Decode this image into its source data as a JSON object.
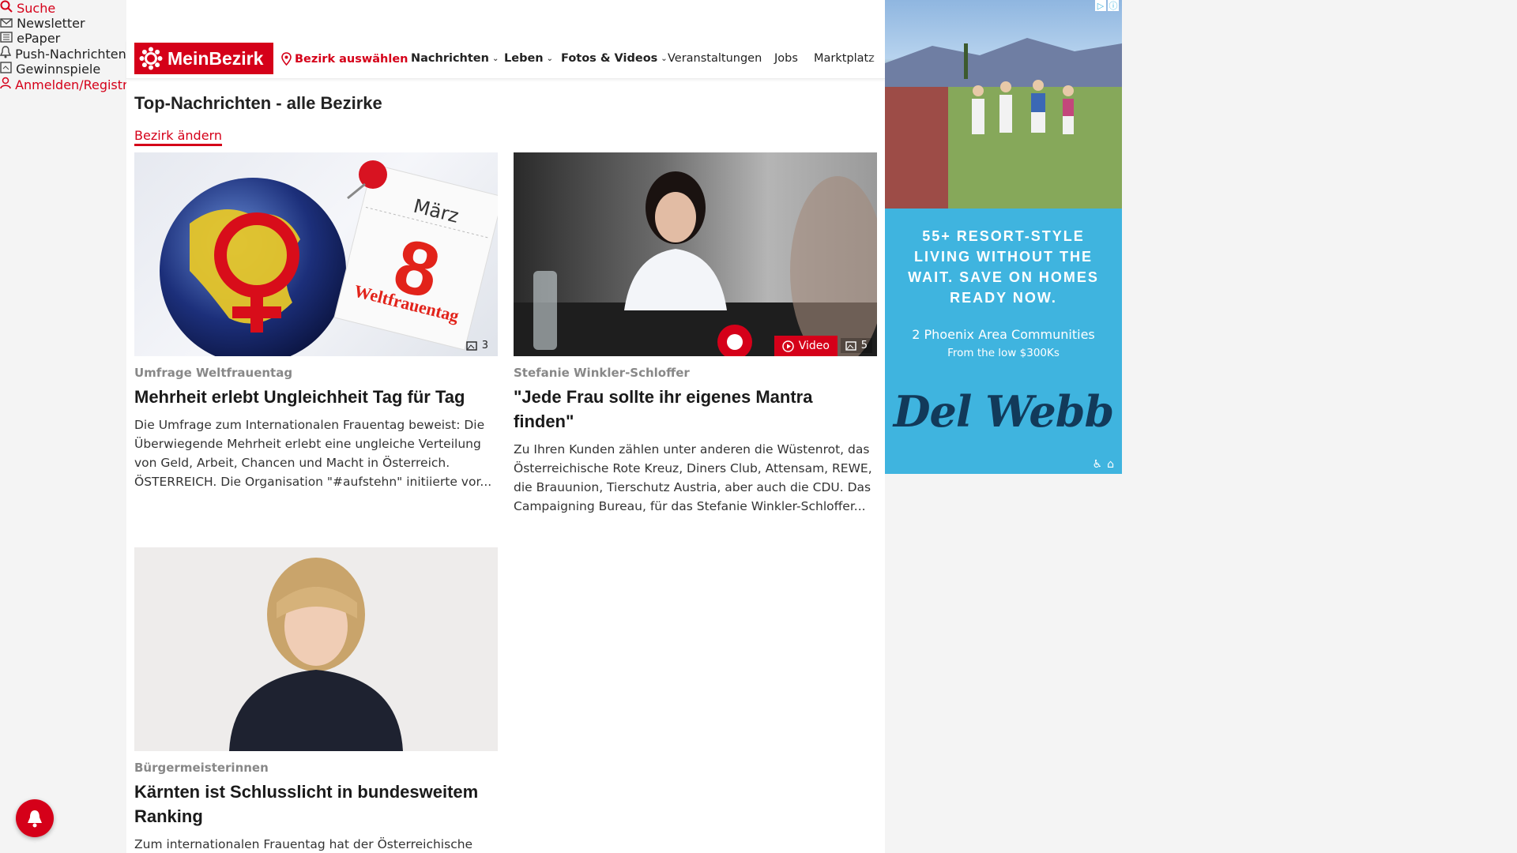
{
  "topbar": {
    "search": "Suche",
    "newsletter": "Newsletter",
    "epaper": "ePaper",
    "push": "Push-Nachrichten",
    "gewinnspiele": "Gewinnspiele",
    "login": "Anmelden/Registrieren"
  },
  "nav": {
    "logo": "MeinBezirk",
    "bezirk": "Bezirk auswählen",
    "items": [
      "Nachrichten",
      "Leben",
      "Fotos & Videos",
      "Veranstaltungen",
      "Jobs",
      "Marktplatz"
    ]
  },
  "page": {
    "title": "Top-Nachrichten - alle Bezirke",
    "change_link": "Bezirk ändern"
  },
  "articles": [
    {
      "category": "Umfrage Weltfrauentag",
      "headline": "Mehrheit erlebt Ungleichheit Tag für Tag",
      "teaser": "Die Umfrage zum Internationalen Frauentag beweist: Die Überwiegende Mehrheit erlebt eine ungleiche Verteilung von Geld, Arbeit, Chancen und Macht in Österreich. ÖSTERREICH. Die Organisation \"#aufstehn\" initiierte vor...",
      "image_count": "3",
      "image_calendar_month": "März",
      "image_calendar_day": "8",
      "image_calendar_label": "Weltfrauentag"
    },
    {
      "category": "Stefanie Winkler-Schloffer",
      "headline": "\"Jede Frau sollte ihr eigenes Mantra finden\"",
      "teaser": "Zu Ihren Kunden zählen unter anderen die Wüstenrot, das Österreichische Rote Kreuz, Diners Club, Attensam, REWE, die Brauunion, Tierschutz Austria, aber auch die CDU. Das Campaigning Bureau, für das Stefanie Winkler-Schloffer...",
      "video_label": "Video",
      "image_count": "5"
    },
    {
      "category": "Bürgermeisterinnen",
      "headline": "Kärnten ist Schlusslicht in bundesweitem Ranking",
      "teaser": "Zum internationalen Frauentag hat der Österreichische"
    }
  ],
  "ad": {
    "headline": "55+ RESORT-STYLE LIVING WITHOUT THE WAIT. SAVE ON HOMES READY NOW.",
    "sub": "2 Phoenix Area Communities",
    "sub2": "From the low $300Ks",
    "brand": "Del Webb",
    "bg_color": "#3fb4df"
  },
  "colors": {
    "accent": "#d50019"
  }
}
